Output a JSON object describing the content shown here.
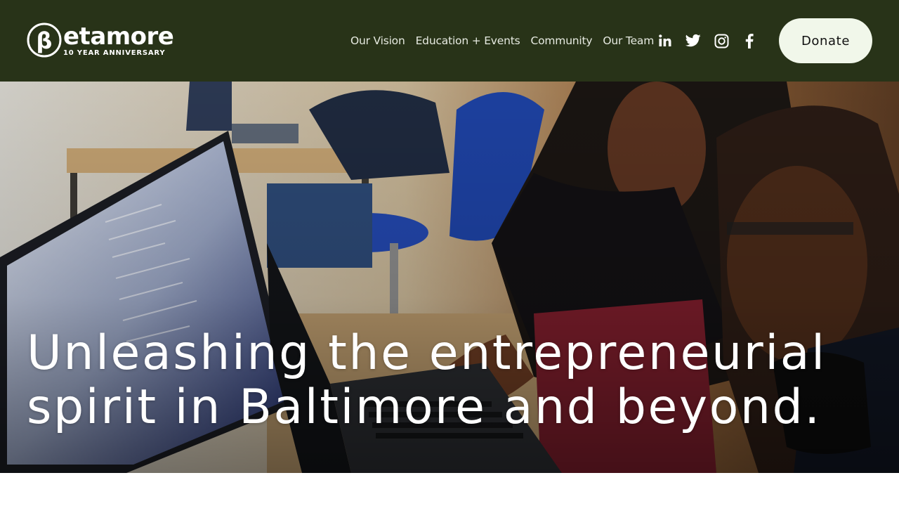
{
  "brand": {
    "name": "Betamore",
    "wordmark": "etamore",
    "mark_letter": "β",
    "tagline": "10 YEAR ANNIVERSARY"
  },
  "nav": {
    "items": [
      {
        "label": "Our Vision"
      },
      {
        "label": "Education + Events"
      },
      {
        "label": "Community"
      },
      {
        "label": "Our Team"
      }
    ]
  },
  "social": {
    "icons": [
      "linkedin-icon",
      "twitter-icon",
      "instagram-icon",
      "facebook-icon"
    ]
  },
  "donate": {
    "label": "Donate"
  },
  "hero": {
    "title": "Unleashing the entrepreneurial spirit in Baltimore and beyond."
  },
  "colors": {
    "header_bg": "#283318",
    "donate_bg": "#f1f7ea",
    "text_light": "#ffffff"
  }
}
